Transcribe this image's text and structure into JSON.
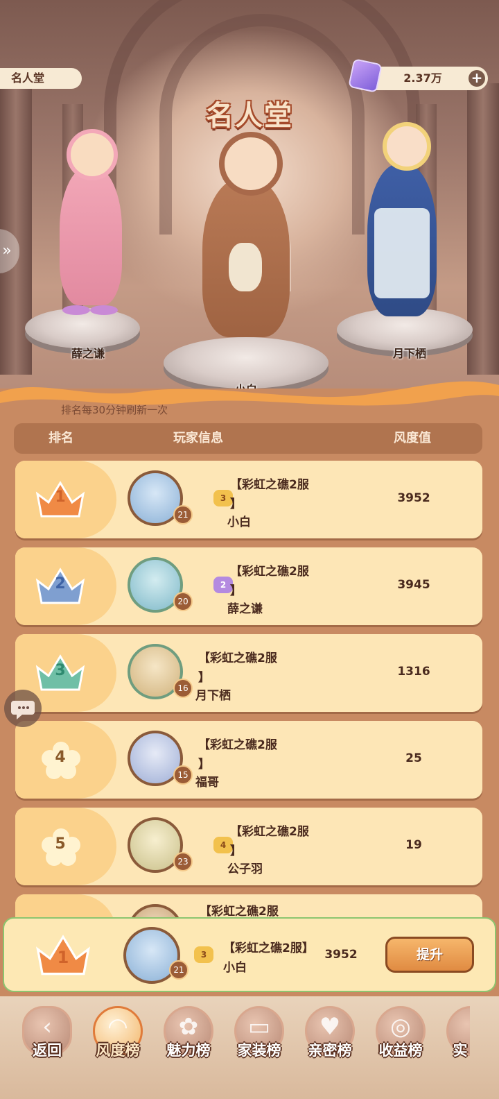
{
  "header": {
    "page_tag": "名人堂",
    "currency_value": "2.37万",
    "add_glyph": "+",
    "title_art": "名人堂"
  },
  "podium": [
    {
      "name": "薛之谦",
      "position": "left"
    },
    {
      "name": "小白",
      "position": "center"
    },
    {
      "name": "月下栖",
      "position": "right"
    }
  ],
  "notice": "排名每30分钟刷新一次",
  "table_headers": {
    "rank": "排名",
    "player": "玩家信息",
    "score": "风度值"
  },
  "rows": [
    {
      "rank": "1",
      "server": "【彩虹之礁2服",
      "bracket": "】",
      "name": "小白",
      "level": "21",
      "medal": "3",
      "score": "3952"
    },
    {
      "rank": "2",
      "server": "【彩虹之礁2服",
      "bracket": "】",
      "name": "薛之谦",
      "level": "20",
      "medal": "2",
      "score": "3945"
    },
    {
      "rank": "3",
      "server": "【彩虹之礁2服",
      "bracket": "】",
      "name": "月下栖",
      "level": "16",
      "medal": "",
      "score": "1316"
    },
    {
      "rank": "4",
      "server": "【彩虹之礁2服",
      "bracket": "】",
      "name": "福哥",
      "level": "15",
      "medal": "",
      "score": "25"
    },
    {
      "rank": "5",
      "server": "【彩虹之礁2服",
      "bracket": "】",
      "name": "公子羽",
      "level": "23",
      "medal": "4",
      "score": "19"
    },
    {
      "rank": "",
      "server": "【彩虹之礁2服",
      "bracket": "",
      "name": "",
      "level": "",
      "medal": "",
      "score": ""
    }
  ],
  "my_rank": {
    "rank": "1",
    "server": "【彩虹之礁2服】",
    "name": "小白",
    "level": "21",
    "medal": "3",
    "score": "3952",
    "button": "提升"
  },
  "nav": [
    {
      "label": "返回",
      "icon": "back-icon"
    },
    {
      "label": "风度榜",
      "icon": "hat-icon"
    },
    {
      "label": "魅力榜",
      "icon": "rose-icon"
    },
    {
      "label": "家装榜",
      "icon": "sofa-icon"
    },
    {
      "label": "亲密榜",
      "icon": "heart-icon"
    },
    {
      "label": "收益榜",
      "icon": "coins-icon"
    },
    {
      "label": "实",
      "icon": "partial-tab-icon"
    }
  ],
  "colors": {
    "rank1": "#f08a45",
    "rank2": "#7f9fd0",
    "rank3": "#6fbfa6",
    "rank_flower": "#fff3d0",
    "accent_green": "#8cc56f"
  }
}
